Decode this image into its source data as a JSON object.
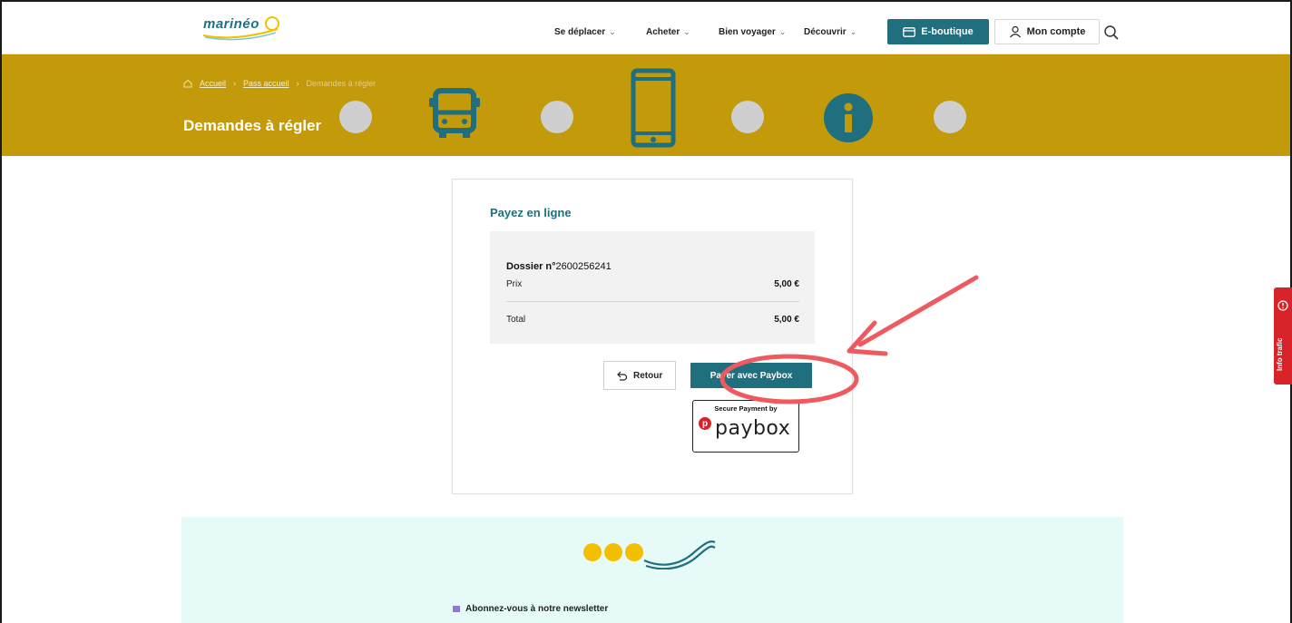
{
  "header": {
    "logo_text": "marinéo",
    "nav": [
      {
        "label": "Se déplacer"
      },
      {
        "label": "Acheter"
      },
      {
        "label": "Bien voyager"
      },
      {
        "label": "Découvrir"
      }
    ],
    "eboutique_label": "E-boutique",
    "account_label": "Mon compte"
  },
  "hero": {
    "breadcrumb": [
      "Accueil",
      "Pass accueil",
      "Demandes à régler"
    ],
    "title": "Demandes à régler"
  },
  "card": {
    "title": "Payez en ligne",
    "dossier_label": "Dossier n°",
    "dossier_number": "2600256241",
    "prix_label": "Prix",
    "prix_value": "5,00 €",
    "total_label": "Total",
    "total_value": "5,00 €",
    "retour_label": "Retour",
    "pay_label": "Payer avec Paybox",
    "badge_top": "Secure Payment by",
    "badge_brand": "paybox"
  },
  "side_tab": {
    "label": "Info trafic"
  },
  "footer": {
    "newsletter_label": "Abonnez-vous à notre newsletter"
  },
  "colors": {
    "accent": "#1f6f7e",
    "hero": "#c29a0a",
    "annotation": "#ee5a5f",
    "alert": "#d8232a",
    "footer_bg": "#e6fbf8"
  }
}
